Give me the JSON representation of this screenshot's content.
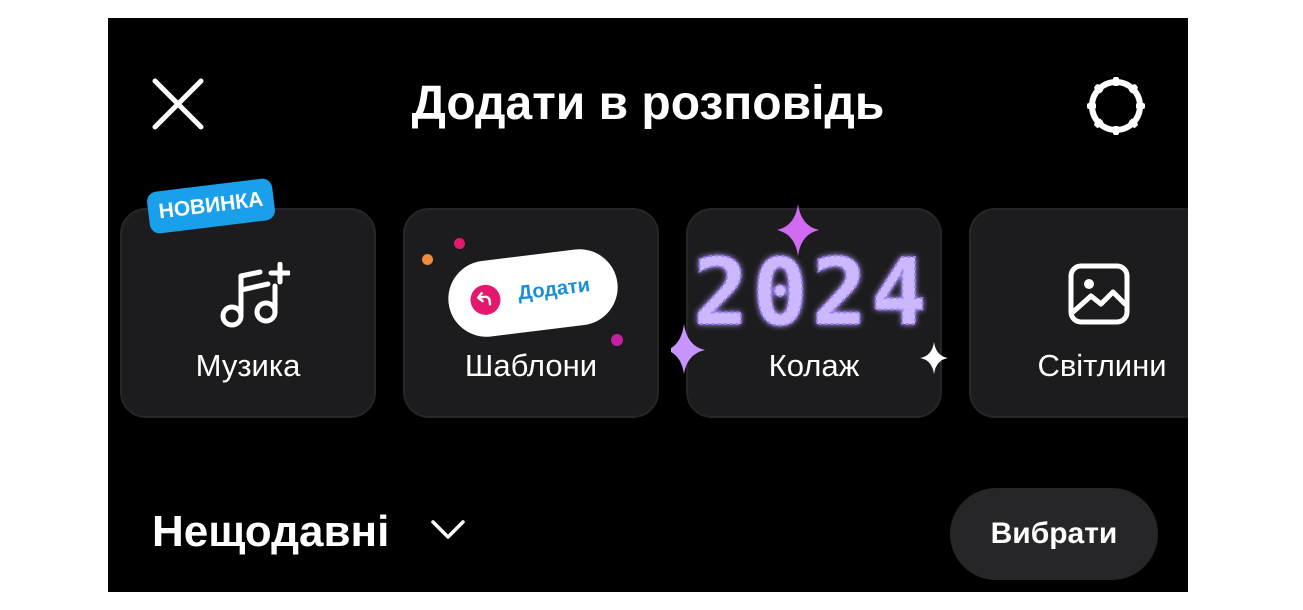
{
  "header": {
    "title": "Додати в розповідь",
    "close_icon": "close-icon",
    "settings_icon": "settings-icon"
  },
  "tiles": [
    {
      "label": "Музика",
      "icon": "music-note-plus-icon",
      "badge": "НОВИНКА"
    },
    {
      "label": "Шаблони",
      "icon": "template-pill-icon",
      "pill_text": "Додати"
    },
    {
      "label": "Колаж",
      "icon": "collage-2024-art",
      "art_text": "2024"
    },
    {
      "label": "Світлини",
      "icon": "photo-icon"
    }
  ],
  "recent": {
    "title": "Нещодавні",
    "dropdown_icon": "chevron-down-icon",
    "select_label": "Вибрати"
  },
  "colors": {
    "background": "#000000",
    "tile_background": "#1c1c1e",
    "badge_blue": "#1aa0ea",
    "pink_accent": "#e3186f",
    "purple_glow": "#b57bff"
  }
}
